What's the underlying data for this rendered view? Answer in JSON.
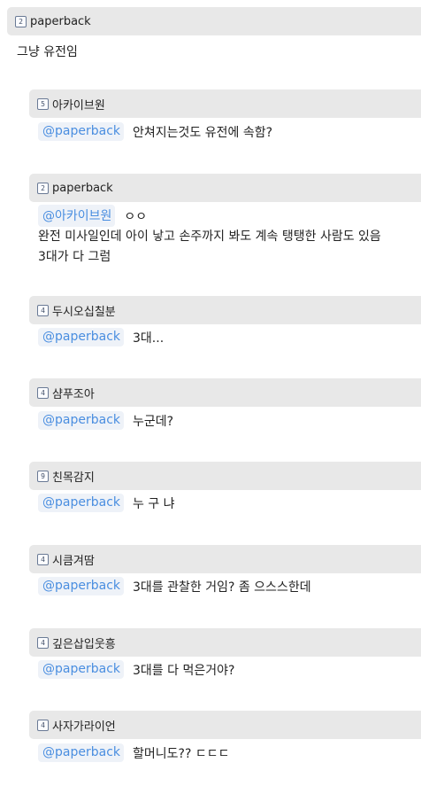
{
  "post": {
    "author": "paperback",
    "level": "2",
    "body": "그냥 유전임"
  },
  "replies": [
    {
      "author": "아카이브원",
      "level": "5",
      "mention": "@paperback",
      "text": "안쳐지는것도 유전에 속함?"
    },
    {
      "author": "paperback",
      "level": "2",
      "mention": "@아카이브원",
      "text": "ㅇㅇ",
      "line2": "완전 미사일인데 아이 낳고 손주까지 봐도 계속 탱탱한 사람도 있음",
      "line3": "3대가 다 그럼"
    },
    {
      "author": "두시오십칠분",
      "level": "4",
      "mention": "@paperback",
      "text": "3대..."
    },
    {
      "author": "샴푸조아",
      "level": "4",
      "mention": "@paperback",
      "text": "누군데?"
    },
    {
      "author": "친목감지",
      "level": "9",
      "mention": "@paperback",
      "text": "누 구 냐"
    },
    {
      "author": "시큼겨땀",
      "level": "4",
      "mention": "@paperback",
      "text": "3대를 관찰한 거임? 좀 으스스한데"
    },
    {
      "author": "깊은삽입웃흥",
      "level": "4",
      "mention": "@paperback",
      "text": "3대를 다 먹은거야?"
    },
    {
      "author": "사자가라이언",
      "level": "4",
      "mention": "@paperback",
      "text": "할머니도?? ㄷㄷㄷ"
    }
  ]
}
